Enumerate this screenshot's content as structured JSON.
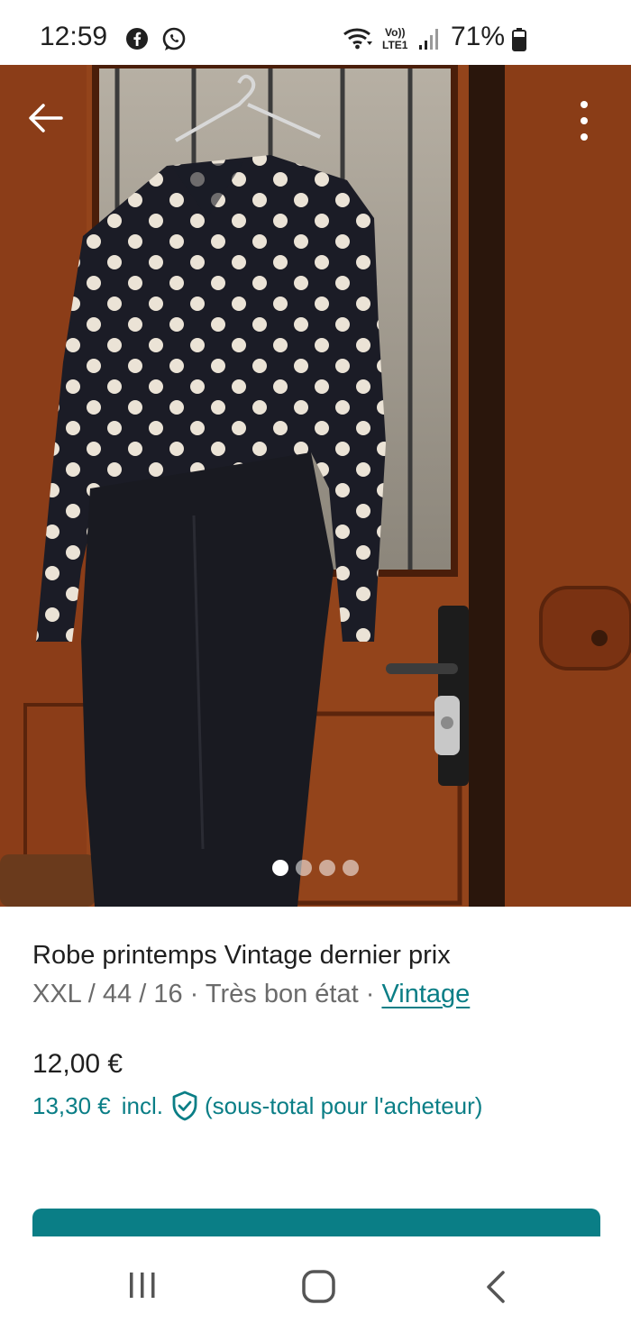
{
  "status_bar": {
    "time": "12:59",
    "battery": "71%",
    "network": "LTE1",
    "icons": [
      "facebook-icon",
      "whatsapp-icon",
      "wifi-icon",
      "volte-icon",
      "signal-icon",
      "battery-icon"
    ]
  },
  "photo": {
    "carousel_count": 4,
    "active_index": 0
  },
  "item": {
    "title": "Robe printemps Vintage dernier prix",
    "size": "XXL / 44 / 16",
    "separator": " · ",
    "condition": "Très bon état",
    "brand": "Vintage",
    "price": "12,00 €",
    "total_price": "13,30 €",
    "incl_label": "incl.",
    "total_note": "(sous-total pour l'acheteur)"
  },
  "colors": {
    "accent": "#0a7e86",
    "text": "#1f1f1f",
    "muted": "#6b6b6b"
  }
}
